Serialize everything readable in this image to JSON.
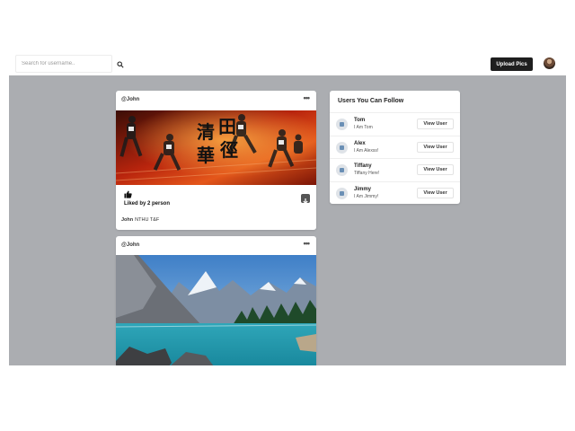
{
  "header": {
    "search_placeholder": "Search for username..",
    "upload_label": "Upload Pics"
  },
  "posts": [
    {
      "user": "@John",
      "liked_text": "Liked by 2 person",
      "caption_user": "John",
      "caption_text": "NTHU T&F",
      "banner_text": [
        "清",
        "華",
        "田",
        "徑"
      ]
    },
    {
      "user": "@John"
    }
  ],
  "follow": {
    "title": "Users You Can Follow",
    "button_label": "View User",
    "users": [
      {
        "name": "Tom",
        "bio": "I Am Tom"
      },
      {
        "name": "Alex",
        "bio": "I Am Alexss!"
      },
      {
        "name": "Tiffany",
        "bio": "Tiffany Here!"
      },
      {
        "name": "Jimmy",
        "bio": "I Am Jimmy!"
      }
    ]
  },
  "colors": {
    "background_gray": "#abadb1",
    "button_dark": "#1e1e1e"
  }
}
